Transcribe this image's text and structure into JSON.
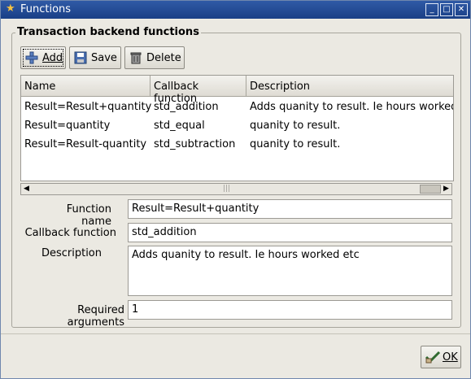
{
  "window": {
    "title": "Functions",
    "controls": {
      "minimize": "_",
      "maximize": "□",
      "close": "✕"
    }
  },
  "group": {
    "title": "Transaction backend functions"
  },
  "toolbar": {
    "add_label": "Add",
    "save_label": "Save",
    "delete_label": "Delete"
  },
  "table": {
    "columns": [
      "Name",
      "Callback function",
      "Description"
    ],
    "rows": [
      {
        "name": "Result=Result+quantity",
        "callback": "std_addition",
        "description": "Adds quanity to result. Ie hours worked"
      },
      {
        "name": "Result=quantity",
        "callback": "std_equal",
        "description": "quanity to result."
      },
      {
        "name": "Result=Result-quantity",
        "callback": "std_subtraction",
        "description": "quanity to result."
      }
    ]
  },
  "form": {
    "function_name_label": "Function name",
    "function_name_value": "Result=Result+quantity",
    "callback_label": "Callback function",
    "callback_value": "std_addition",
    "description_label": "Description",
    "description_value": "Adds quanity to result. Ie hours worked etc",
    "required_args_label": "Required arguments",
    "required_args_value": "1"
  },
  "footer": {
    "ok_label": "OK"
  },
  "icons": {
    "title": "star-icon",
    "add": "plus-icon",
    "save": "floppy-disk-icon",
    "delete": "trash-icon",
    "ok": "checkmark-hand-icon"
  }
}
